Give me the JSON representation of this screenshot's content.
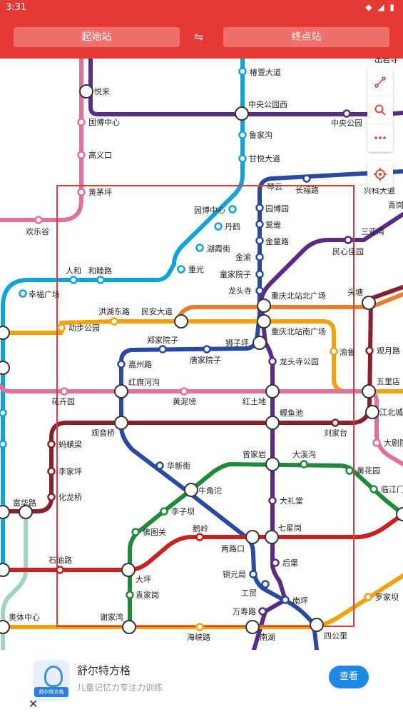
{
  "status_bar": {
    "time": "3:31"
  },
  "header": {
    "start_placeholder": "起始站",
    "end_placeholder": "终点站",
    "swap_symbol": "⇋"
  },
  "colors": {
    "header": "#e53935",
    "line_pink": "#e2709a",
    "line_purple": "#5b2c86",
    "line_blue": "#2a49a5",
    "line_cyan": "#0ba5dc",
    "line_orange": "#f2a20d",
    "line_green": "#1f8a3c",
    "line_red": "#cc1f1f",
    "line_darkred": "#8b1f2e",
    "line_lightorange": "#e87d2b",
    "line_mint": "#9fd3c4",
    "selection_box": "#e53935"
  },
  "tools": {
    "route_icon": "route-icon",
    "search_icon": "search-icon",
    "more_icon": "more-icon",
    "locate_icon": "crosshair-icon"
  },
  "map": {
    "stations": [
      "出岩寺",
      "悦来",
      "椿萱大道",
      "中央公园西",
      "中央公园",
      "国博中心",
      "鲁家沟",
      "高义口",
      "甘悦大道",
      "黄茅坪",
      "兴科大道",
      "琴云",
      "长福路",
      "园博中心",
      "园博园",
      "青岗",
      "丹鹤",
      "鸳鸯",
      "三亚湾",
      "欢乐谷",
      "湖霞街",
      "金童路",
      "民心佳园",
      "金渝",
      "人和",
      "和睦路",
      "重光",
      "童家院子",
      "幸福广场",
      "龙头寺",
      "重庆北站北广场",
      "头塘",
      "洪湖东路",
      "民安大道",
      "动步公园",
      "重庆北站南广场",
      "渝鲁",
      "观月路",
      "郑家院子",
      "狮子坪",
      "唐家院子",
      "龙头寺公园",
      "嘉州路",
      "五里店",
      "红旗河沟",
      "花卉园",
      "黄泥塝",
      "红土地",
      "江北城",
      "鲤鱼池",
      "观音桥",
      "刘家台",
      "大剧院",
      "蚂蟥梁",
      "曾家岩",
      "大溪沟",
      "华新街",
      "李家坪",
      "黄花园",
      "牛角沱",
      "临江门",
      "化龙桥",
      "大礼堂",
      "李子坝",
      "富华路",
      "佛图关",
      "鹅岭",
      "七星岗",
      "两路口",
      "石油路",
      "后堡",
      "大坪",
      "铜元局",
      "工贸",
      "南坪",
      "袁家岗",
      "罗家坝",
      "奥体中心",
      "谢家湾",
      "万寿路",
      "海峡路",
      "南湖",
      "四公里"
    ]
  },
  "ad": {
    "title": "舒尔特方格",
    "subtitle": "儿童记忆力专注力训练",
    "button": "查看",
    "logo_text": "舒尔特方格",
    "close": "✕"
  }
}
